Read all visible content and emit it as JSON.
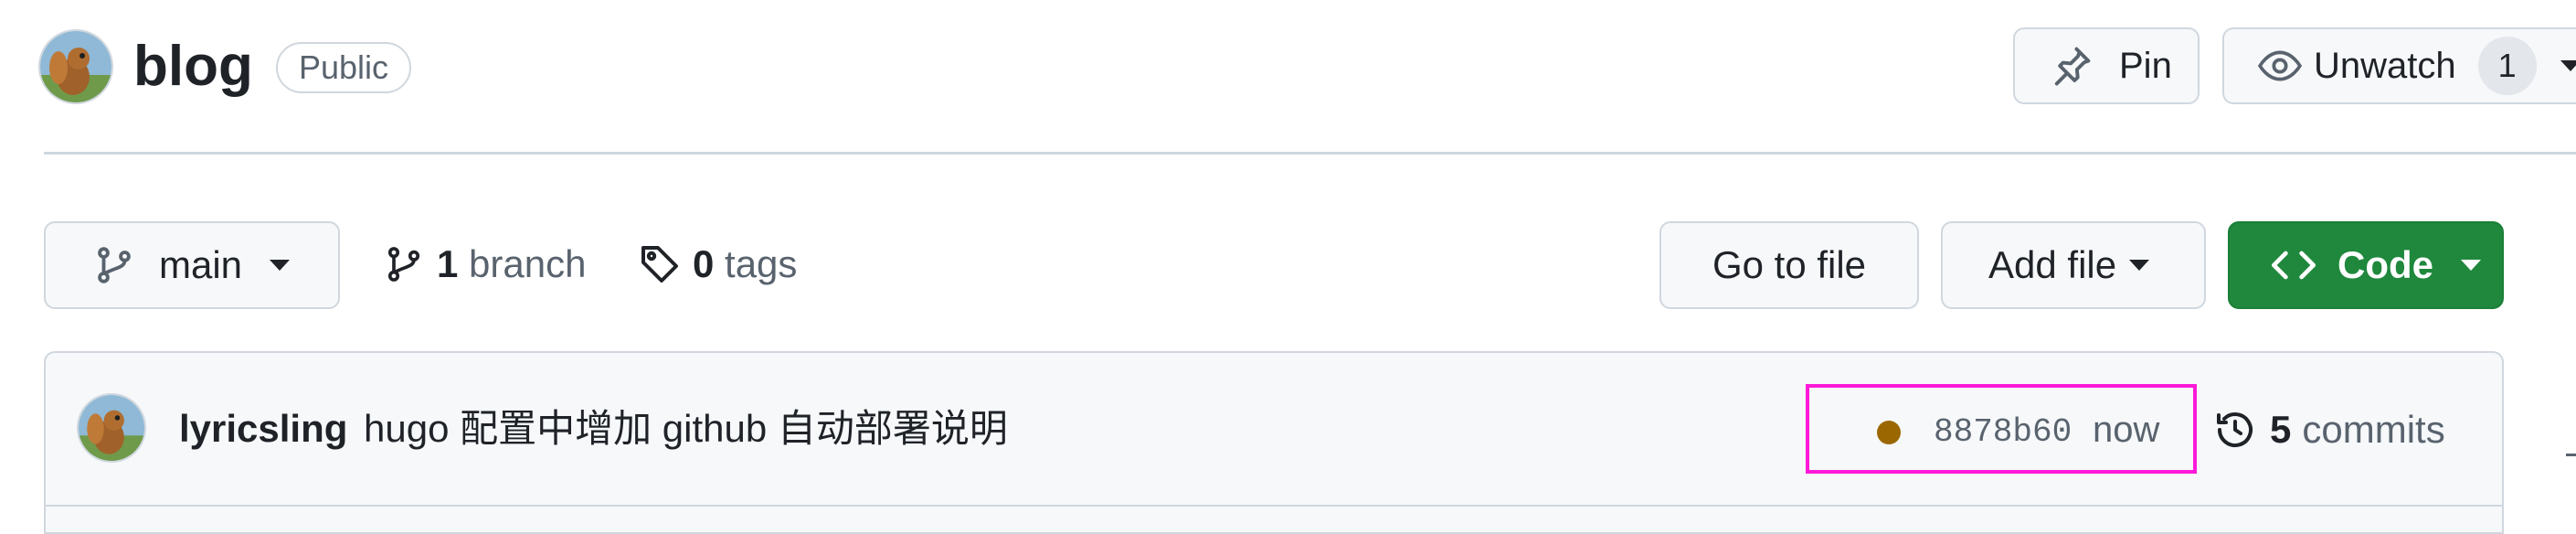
{
  "repo": {
    "name": "blog",
    "visibility": "Public"
  },
  "header_actions": {
    "pin_label": "Pin",
    "unwatch_label": "Unwatch",
    "watch_count": "1"
  },
  "toolbar": {
    "current_branch": "main",
    "branch_count": "1",
    "branch_label": "branch",
    "tag_count": "0",
    "tag_label": "tags",
    "goto_file_label": "Go to file",
    "add_file_label": "Add file",
    "code_label": "Code"
  },
  "latest_commit": {
    "author": "lyricsling",
    "message": "hugo 配置中增加 github 自动部署说明",
    "sha": "8878b60",
    "time": "now",
    "commit_count": "5",
    "commit_label": "commits",
    "status_color": "#9a6700"
  },
  "colors": {
    "primary_green": "#1f883d",
    "border": "#d0d7de",
    "muted_text": "#59636e",
    "highlight": "#ff1ad9"
  },
  "icons": {
    "pin": "pin-icon",
    "eye": "eye-icon",
    "branch": "git-branch-icon",
    "tag": "tag-icon",
    "code": "code-icon",
    "history": "history-icon"
  }
}
